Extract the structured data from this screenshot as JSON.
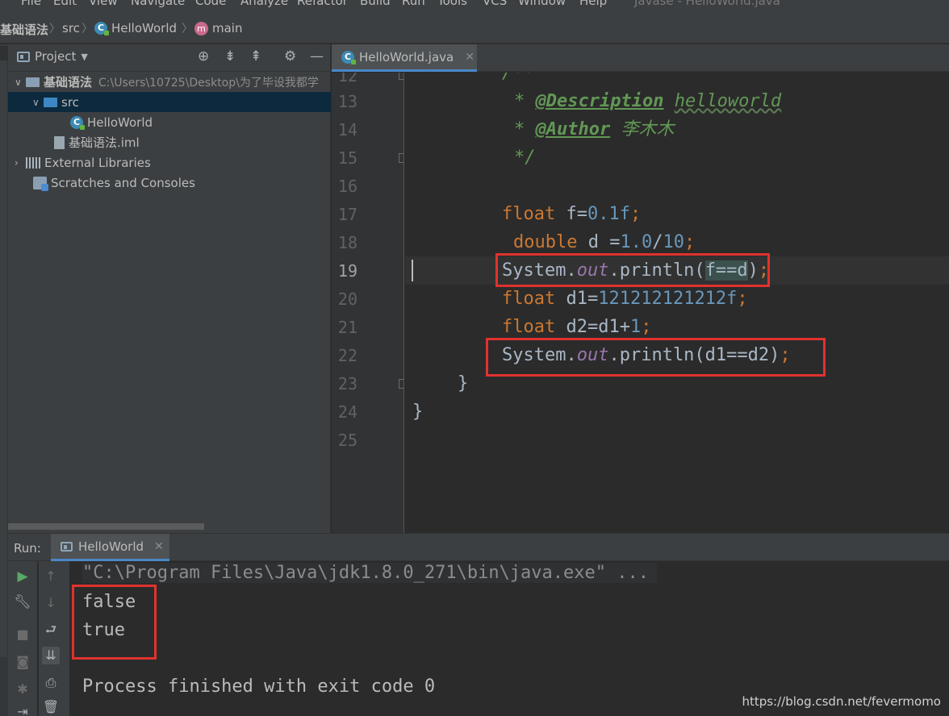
{
  "menu": {
    "items": [
      "File",
      "Edit",
      "View",
      "Navigate",
      "Code",
      "Analyze",
      "Refactor",
      "Build",
      "Run",
      "Tools",
      "VCS",
      "Window",
      "Help"
    ],
    "window_title": "Javase - HelloWorld.java"
  },
  "breadcrumb": {
    "project": "基础语法",
    "folder": "src",
    "class": "HelloWorld",
    "method": "main"
  },
  "project_panel": {
    "title": "Project",
    "tree": [
      {
        "label": "基础语法",
        "path": "C:\\Users\\10725\\Desktop\\为了毕设我都学"
      },
      {
        "label": "src"
      },
      {
        "label": "HelloWorld"
      },
      {
        "label": "基础语法.iml"
      },
      {
        "label": "External Libraries"
      },
      {
        "label": "Scratches and Consoles"
      }
    ]
  },
  "editor": {
    "tab_label": "HelloWorld.java",
    "line_numbers": [
      "12",
      "13",
      "14",
      "15",
      "16",
      "17",
      "18",
      "19",
      "20",
      "21",
      "22",
      "23",
      "24",
      "25"
    ],
    "current_line": "19"
  },
  "run_panel": {
    "label": "Run:",
    "tab_label": "HelloWorld",
    "console": {
      "command": "\"C:\\Program Files\\Java\\jdk1.8.0_271\\bin\\java.exe\" ...",
      "out1": "false",
      "out2": "true",
      "exit": "Process finished with exit code 0"
    }
  },
  "watermark": "https://blog.csdn.net/fevermomo",
  "colors": {
    "highlight_box": "#e0322f",
    "accent": "#4a88c7"
  }
}
